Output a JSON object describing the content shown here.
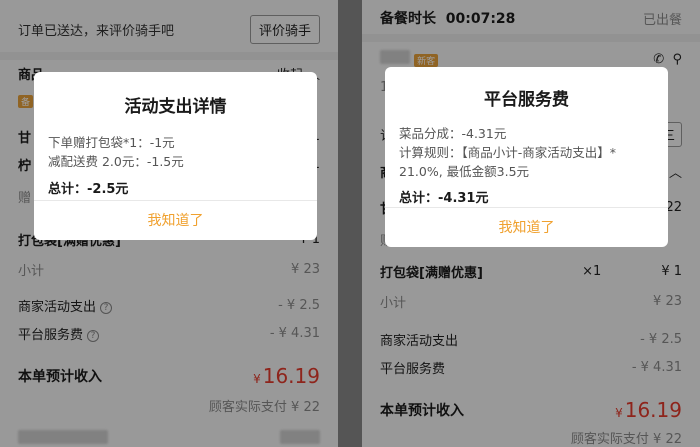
{
  "left": {
    "header_text": "订单已送达，来评价骑手吧",
    "rate_button": "评价骑手",
    "section_goods": "商品",
    "collapse": "收起",
    "collapse_icon": "chevron-up-icon",
    "item1_prefix": "甘",
    "item1_price": "11",
    "item2_prefix": "柠",
    "item2_price": "11",
    "item3_prefix": "赠",
    "bag_label": "打包袋[满赠优惠]",
    "bag_price": "¥ 1",
    "subtotal_label": "小计",
    "subtotal_value": "¥ 23",
    "activity_label": "商家活动支出",
    "activity_value": "- ¥ 2.5",
    "platform_label": "平台服务费",
    "platform_value": "- ¥ 4.31",
    "income_label": "本单预计收入",
    "income_currency": "¥",
    "income_value": "16.19",
    "customer_paid": "顾客实际支付 ¥ 22",
    "modal": {
      "title": "活动支出详情",
      "line1": "下单赠打包袋*1：-1元",
      "line2": "减配送费 2.0元：-1.5元",
      "total": "总计：-2.5元",
      "button": "我知道了"
    }
  },
  "right": {
    "header_label": "备餐时长",
    "header_time": "00:07:28",
    "status": "已出餐",
    "phone_prefix": "17",
    "phone_icon": "phone-icon",
    "location_icon": "location-pin-icon",
    "order_prefix": "订",
    "section_prefix": "商",
    "item_prefix": "甘",
    "item_price": "22",
    "gift_prefix": "赠",
    "bag_label": "打包袋[满赠优惠]",
    "bag_qty": "×1",
    "bag_price": "¥ 1",
    "subtotal_label": "小计",
    "subtotal_value": "¥ 23",
    "activity_label": "商家活动支出",
    "activity_value": "- ¥ 2.5",
    "platform_label": "平台服务费",
    "platform_value": "- ¥ 4.31",
    "income_label": "本单预计收入",
    "income_currency": "¥",
    "income_value": "16.19",
    "customer_paid": "顾客实际支付 ¥ 22",
    "modal": {
      "title": "平台服务费",
      "line1": "菜品分成：-4.31元",
      "line2": "计算规则：【商品小计-商家活动支出】* 21.0%, 最低金额3.5元",
      "total": "总计：-4.31元",
      "button": "我知道了"
    }
  },
  "colors": {
    "accent": "#f0a12f",
    "price": "#e53b2c"
  }
}
